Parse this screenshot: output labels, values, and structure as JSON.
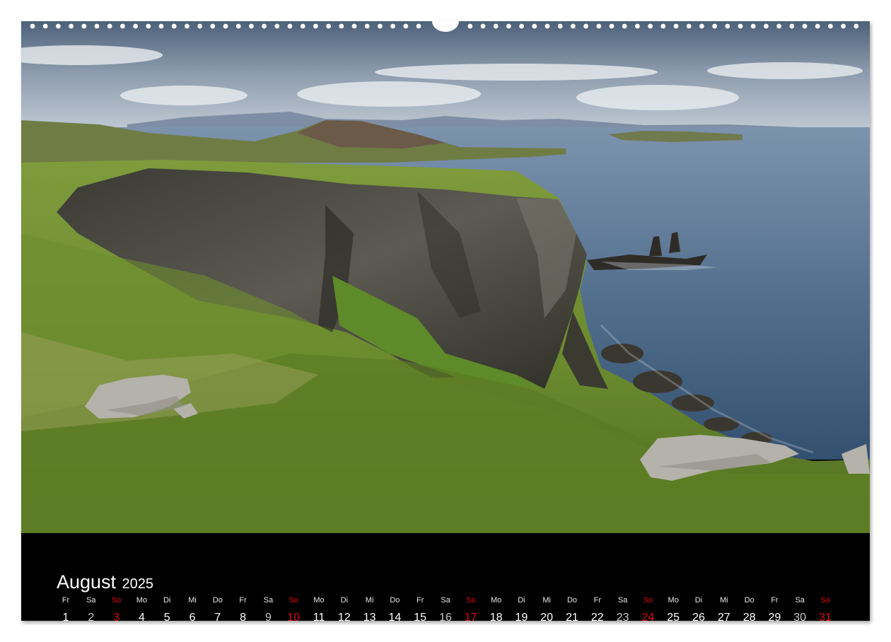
{
  "calendar": {
    "month": "August",
    "year": "2025",
    "days": [
      {
        "wd": "Fr",
        "d": "1"
      },
      {
        "wd": "Sa",
        "d": "2"
      },
      {
        "wd": "So",
        "d": "3"
      },
      {
        "wd": "Mo",
        "d": "4"
      },
      {
        "wd": "Di",
        "d": "5"
      },
      {
        "wd": "Mi",
        "d": "6"
      },
      {
        "wd": "Do",
        "d": "7"
      },
      {
        "wd": "Fr",
        "d": "8"
      },
      {
        "wd": "Sa",
        "d": "9"
      },
      {
        "wd": "So",
        "d": "10"
      },
      {
        "wd": "Mo",
        "d": "11"
      },
      {
        "wd": "Di",
        "d": "12"
      },
      {
        "wd": "Mi",
        "d": "13"
      },
      {
        "wd": "Do",
        "d": "14"
      },
      {
        "wd": "Fr",
        "d": "15"
      },
      {
        "wd": "Sa",
        "d": "16"
      },
      {
        "wd": "So",
        "d": "17"
      },
      {
        "wd": "Mo",
        "d": "18"
      },
      {
        "wd": "Di",
        "d": "19"
      },
      {
        "wd": "Mi",
        "d": "20"
      },
      {
        "wd": "Do",
        "d": "21"
      },
      {
        "wd": "Fr",
        "d": "22"
      },
      {
        "wd": "Sa",
        "d": "23"
      },
      {
        "wd": "So",
        "d": "24"
      },
      {
        "wd": "Mo",
        "d": "25"
      },
      {
        "wd": "Di",
        "d": "26"
      },
      {
        "wd": "Mi",
        "d": "27"
      },
      {
        "wd": "Do",
        "d": "28"
      },
      {
        "wd": "Fr",
        "d": "29"
      },
      {
        "wd": "Sa",
        "d": "30"
      },
      {
        "wd": "So",
        "d": "31"
      }
    ]
  },
  "colors": {
    "sunday": "#e30613",
    "background": "#000000"
  }
}
